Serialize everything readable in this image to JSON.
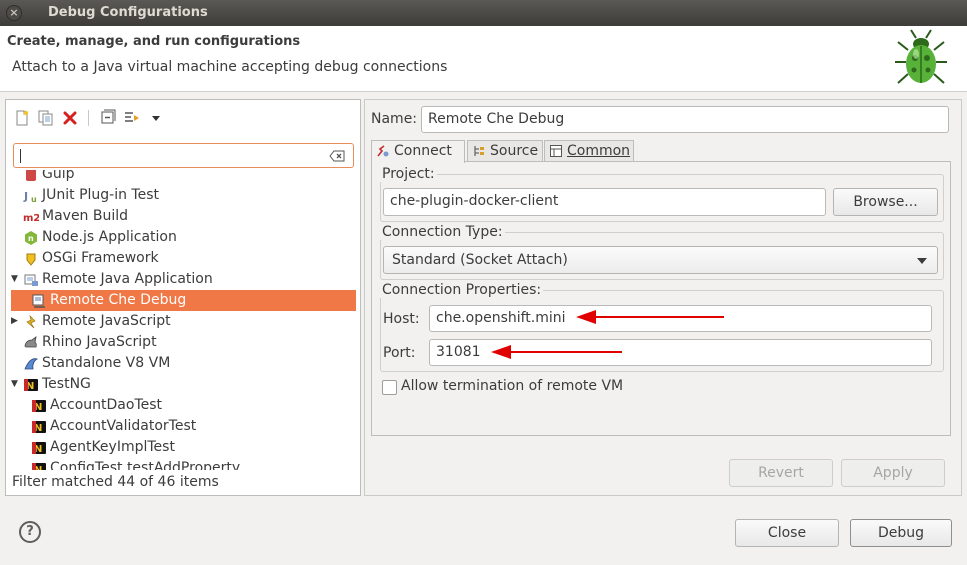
{
  "window": {
    "title": "Debug Configurations",
    "close_symbol": "×"
  },
  "header": {
    "title": "Create, manage, and run configurations",
    "description": "Attach to a Java virtual machine accepting debug connections",
    "logo_icon": "bug-icon"
  },
  "left": {
    "toolbar": {
      "new_icon": "new-config-icon",
      "duplicate_icon": "duplicate-icon",
      "delete_icon": "delete-icon",
      "collapse_icon": "collapse-all-icon",
      "filter_icon": "filter-icon",
      "menu_icon": "view-menu-chevron-icon"
    },
    "filter_value": "",
    "tree": [
      {
        "label": "Gulp",
        "icon": "gulp-icon",
        "partial": true
      },
      {
        "label": "JUnit Plug-in Test",
        "icon": "junit-plugin-icon"
      },
      {
        "label": "Maven Build",
        "icon": "maven-icon",
        "icon_text": "m2"
      },
      {
        "label": "Node.js Application",
        "icon": "nodejs-icon",
        "icon_text": "n"
      },
      {
        "label": "OSGi Framework",
        "icon": "osgi-icon"
      },
      {
        "label": "Remote Java Application",
        "icon": "remote-java-icon",
        "expanded": true
      },
      {
        "label": "Remote Che Debug",
        "icon": "remote-config-icon",
        "selected": true,
        "child": true
      },
      {
        "label": "Remote JavaScript",
        "icon": "remote-js-icon",
        "collapsed": true
      },
      {
        "label": "Rhino JavaScript",
        "icon": "rhino-icon"
      },
      {
        "label": "Standalone V8 VM",
        "icon": "v8-icon"
      },
      {
        "label": "TestNG",
        "icon": "testng-icon",
        "expanded": true
      },
      {
        "label": "AccountDaoTest",
        "icon": "testng-icon",
        "child": true
      },
      {
        "label": "AccountValidatorTest",
        "icon": "testng-icon",
        "child": true
      },
      {
        "label": "AgentKeyImplTest",
        "icon": "testng-icon",
        "child": true
      },
      {
        "label": "ConfigTest.testAddProperty",
        "icon": "testng-icon",
        "child": true,
        "partial": true
      }
    ],
    "status": "Filter matched 44 of 46 items"
  },
  "right": {
    "name_label": "Name:",
    "name_value": "Remote Che Debug",
    "tabs": [
      {
        "label": "Connect",
        "icon": "connect-icon",
        "active": true
      },
      {
        "label": "Source",
        "icon": "source-icon"
      },
      {
        "label": "Common",
        "icon": "common-icon"
      }
    ],
    "project": {
      "group_label": "Project:",
      "value": "che-plugin-docker-client",
      "browse_label": "Browse..."
    },
    "connection_type": {
      "group_label": "Connection Type:",
      "value": "Standard (Socket Attach)"
    },
    "connection_properties": {
      "group_label": "Connection Properties:",
      "host_label": "Host:",
      "host_value": "che.openshift.mini",
      "port_label": "Port:",
      "port_value": "31081"
    },
    "allow_termination": {
      "label": "Allow termination of remote VM",
      "checked": false
    },
    "revert_label": "Revert",
    "apply_label": "Apply"
  },
  "footer": {
    "help_symbol": "?",
    "close_label": "Close",
    "debug_label": "Debug"
  },
  "colors": {
    "selection": "#f07746",
    "annotation_arrow": "#e00000",
    "filter_border": "#e88c5a"
  }
}
